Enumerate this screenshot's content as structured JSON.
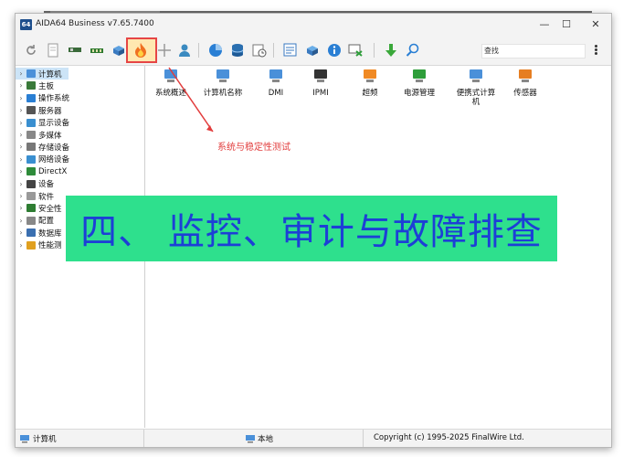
{
  "window": {
    "app_icon": "64",
    "title": "AIDA64 Business v7.65.7400",
    "controls": {
      "minimize": "—",
      "maximize": "☐",
      "close": "✕"
    }
  },
  "toolbar": {
    "search_placeholder": "查找",
    "icons": [
      "refresh-icon",
      "report-icon",
      "board-icon",
      "memory-icon",
      "network-icon",
      "stability-test-icon",
      "tools-icon",
      "user-icon",
      "chart-icon",
      "database-icon",
      "schedule-icon",
      "audit-icon",
      "update-icon",
      "info-icon",
      "remote-icon",
      "download-icon",
      "search-icon"
    ]
  },
  "tree": {
    "items": [
      {
        "label": "计算机",
        "icon": "computer-icon",
        "color": "#4a90d9"
      },
      {
        "label": "主板",
        "icon": "motherboard-icon",
        "color": "#3a7a3a"
      },
      {
        "label": "操作系统",
        "icon": "windows-icon",
        "color": "#2a7fd4"
      },
      {
        "label": "服务器",
        "icon": "server-icon",
        "color": "#555555"
      },
      {
        "label": "显示设备",
        "icon": "display-icon",
        "color": "#3a8fd0"
      },
      {
        "label": "多媒体",
        "icon": "multimedia-icon",
        "color": "#888888"
      },
      {
        "label": "存储设备",
        "icon": "storage-icon",
        "color": "#777777"
      },
      {
        "label": "网络设备",
        "icon": "network-icon",
        "color": "#3a8fd0"
      },
      {
        "label": "DirectX",
        "icon": "directx-icon",
        "color": "#2e8b3a"
      },
      {
        "label": "设备",
        "icon": "device-icon",
        "color": "#444444"
      },
      {
        "label": "软件",
        "icon": "software-icon",
        "color": "#999999"
      },
      {
        "label": "安全性",
        "icon": "security-icon",
        "color": "#2e7d32"
      },
      {
        "label": "配置",
        "icon": "config-icon",
        "color": "#888888"
      },
      {
        "label": "数据库",
        "icon": "database-icon",
        "color": "#3a6fb0"
      },
      {
        "label": "性能测",
        "icon": "benchmark-icon",
        "color": "#e0a020"
      }
    ]
  },
  "content": {
    "items": [
      {
        "label": "系统概述",
        "icon": "computer-icon",
        "color": "#4a90d9"
      },
      {
        "label": "计算机名称",
        "icon": "computer-name-icon",
        "color": "#4a90d9"
      },
      {
        "label": "DMI",
        "icon": "dmi-icon",
        "color": "#4a90d9"
      },
      {
        "label": "IPMI",
        "icon": "ipmi-icon",
        "color": "#333333"
      },
      {
        "label": "超频",
        "icon": "overclock-icon",
        "color": "#f08a24"
      },
      {
        "label": "电源管理",
        "icon": "power-icon",
        "color": "#2e9e3a"
      },
      {
        "label": "便携式计算机",
        "icon": "laptop-icon",
        "color": "#4a90d9"
      },
      {
        "label": "传感器",
        "icon": "sensor-icon",
        "color": "#e67e22"
      }
    ],
    "annotation": "系统与稳定性测试"
  },
  "statusbar": {
    "left": "计算机",
    "middle": "本地",
    "right": "Copyright (c) 1995-2025 FinalWire Ltd."
  },
  "banner": {
    "text": "四、 监控、审计与故障排查"
  },
  "colors": {
    "highlight_box": "#e64545",
    "annotation": "#e23d3d",
    "banner_bg": "#2ee08d",
    "banner_text": "#1d3fd6"
  }
}
